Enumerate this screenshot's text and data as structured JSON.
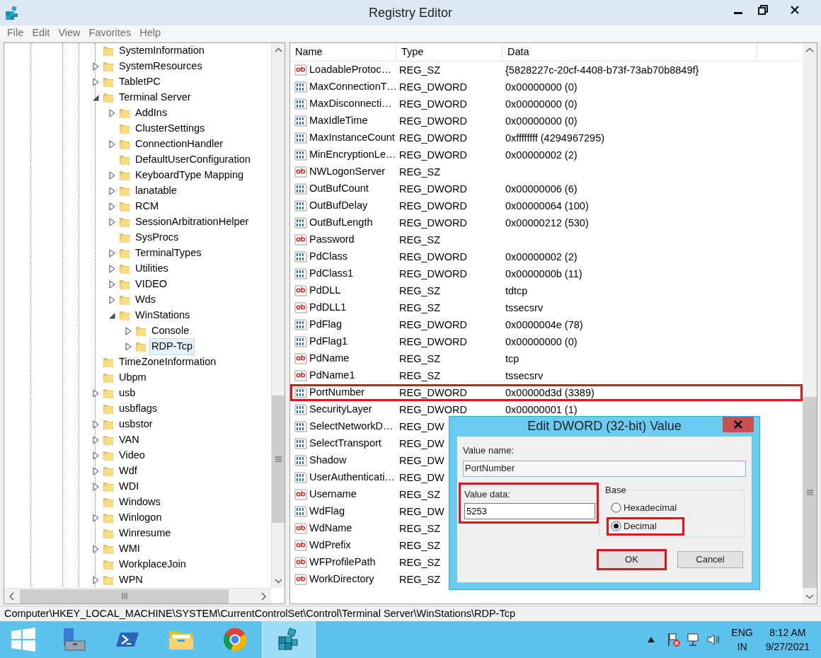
{
  "window": {
    "title": "Registry Editor"
  },
  "menu": [
    "File",
    "Edit",
    "View",
    "Favorites",
    "Help"
  ],
  "tree": [
    {
      "label": "SystemInformation",
      "expandable": false,
      "selected": false
    },
    {
      "label": "SystemResources",
      "expandable": true,
      "expanded": false,
      "selected": false
    },
    {
      "label": "TabletPC",
      "expandable": true,
      "expanded": false,
      "selected": false
    },
    {
      "label": "Terminal Server",
      "expandable": true,
      "expanded": true,
      "selected": false,
      "children": [
        {
          "label": "AddIns",
          "expandable": true,
          "expanded": false,
          "selected": false
        },
        {
          "label": "ClusterSettings",
          "expandable": false,
          "selected": false
        },
        {
          "label": "ConnectionHandler",
          "expandable": true,
          "expanded": false,
          "selected": false
        },
        {
          "label": "DefaultUserConfiguration",
          "expandable": false,
          "selected": false
        },
        {
          "label": "KeyboardType Mapping",
          "expandable": true,
          "expanded": false,
          "selected": false
        },
        {
          "label": "lanatable",
          "expandable": true,
          "expanded": false,
          "selected": false
        },
        {
          "label": "RCM",
          "expandable": true,
          "expanded": false,
          "selected": false
        },
        {
          "label": "SessionArbitrationHelper",
          "expandable": true,
          "expanded": false,
          "selected": false
        },
        {
          "label": "SysProcs",
          "expandable": false,
          "selected": false
        },
        {
          "label": "TerminalTypes",
          "expandable": true,
          "expanded": false,
          "selected": false
        },
        {
          "label": "Utilities",
          "expandable": true,
          "expanded": false,
          "selected": false
        },
        {
          "label": "VIDEO",
          "expandable": true,
          "expanded": false,
          "selected": false
        },
        {
          "label": "Wds",
          "expandable": true,
          "expanded": false,
          "selected": false
        },
        {
          "label": "WinStations",
          "expandable": true,
          "expanded": true,
          "selected": false,
          "children": [
            {
              "label": "Console",
              "expandable": true,
              "expanded": false,
              "selected": false
            },
            {
              "label": "RDP-Tcp",
              "expandable": true,
              "expanded": false,
              "selected": true
            }
          ]
        }
      ]
    },
    {
      "label": "TimeZoneInformation",
      "expandable": false,
      "selected": false
    },
    {
      "label": "Ubpm",
      "expandable": false,
      "selected": false
    },
    {
      "label": "usb",
      "expandable": true,
      "expanded": false,
      "selected": false
    },
    {
      "label": "usbflags",
      "expandable": false,
      "selected": false
    },
    {
      "label": "usbstor",
      "expandable": true,
      "expanded": false,
      "selected": false
    },
    {
      "label": "VAN",
      "expandable": true,
      "expanded": false,
      "selected": false
    },
    {
      "label": "Video",
      "expandable": true,
      "expanded": false,
      "selected": false
    },
    {
      "label": "Wdf",
      "expandable": true,
      "expanded": false,
      "selected": false
    },
    {
      "label": "WDI",
      "expandable": true,
      "expanded": false,
      "selected": false
    },
    {
      "label": "Windows",
      "expandable": false,
      "selected": false
    },
    {
      "label": "Winlogon",
      "expandable": true,
      "expanded": false,
      "selected": false
    },
    {
      "label": "Winresume",
      "expandable": false,
      "selected": false
    },
    {
      "label": "WMI",
      "expandable": true,
      "expanded": false,
      "selected": false
    },
    {
      "label": "WorkplaceJoin",
      "expandable": false,
      "selected": false
    },
    {
      "label": "WPN",
      "expandable": true,
      "expanded": false,
      "selected": false
    }
  ],
  "list": {
    "columns": [
      "Name",
      "Type",
      "Data"
    ],
    "rows": [
      {
        "name": "LoadableProtoc…",
        "type": "REG_SZ",
        "data": "{5828227c-20cf-4408-b73f-73ab70b8849f}",
        "kind": "string",
        "highlighted": false
      },
      {
        "name": "MaxConnectionT…",
        "type": "REG_DWORD",
        "data": "0x00000000 (0)",
        "kind": "dword",
        "highlighted": false
      },
      {
        "name": "MaxDisconnecti…",
        "type": "REG_DWORD",
        "data": "0x00000000 (0)",
        "kind": "dword",
        "highlighted": false
      },
      {
        "name": "MaxIdleTime",
        "type": "REG_DWORD",
        "data": "0x00000000 (0)",
        "kind": "dword",
        "highlighted": false
      },
      {
        "name": "MaxInstanceCount",
        "type": "REG_DWORD",
        "data": "0xffffffff (4294967295)",
        "kind": "dword",
        "highlighted": false
      },
      {
        "name": "MinEncryptionLe…",
        "type": "REG_DWORD",
        "data": "0x00000002 (2)",
        "kind": "dword",
        "highlighted": false
      },
      {
        "name": "NWLogonServer",
        "type": "REG_SZ",
        "kind": "string",
        "highlighted": false
      },
      {
        "name": "OutBufCount",
        "type": "REG_DWORD",
        "data": "0x00000006 (6)",
        "kind": "dword",
        "highlighted": false
      },
      {
        "name": "OutBufDelay",
        "type": "REG_DWORD",
        "data": "0x00000064 (100)",
        "kind": "dword",
        "highlighted": false
      },
      {
        "name": "OutBufLength",
        "type": "REG_DWORD",
        "data": "0x00000212 (530)",
        "kind": "dword",
        "highlighted": false
      },
      {
        "name": "Password",
        "type": "REG_SZ",
        "kind": "string",
        "highlighted": false
      },
      {
        "name": "PdClass",
        "type": "REG_DWORD",
        "data": "0x00000002 (2)",
        "kind": "dword",
        "highlighted": false
      },
      {
        "name": "PdClass1",
        "type": "REG_DWORD",
        "data": "0x0000000b (11)",
        "kind": "dword",
        "highlighted": false
      },
      {
        "name": "PdDLL",
        "type": "REG_SZ",
        "data": "tdtcp",
        "kind": "string",
        "highlighted": false
      },
      {
        "name": "PdDLL1",
        "type": "REG_SZ",
        "data": "tssecsrv",
        "kind": "string",
        "highlighted": false
      },
      {
        "name": "PdFlag",
        "type": "REG_DWORD",
        "data": "0x0000004e (78)",
        "kind": "dword",
        "highlighted": false
      },
      {
        "name": "PdFlag1",
        "type": "REG_DWORD",
        "data": "0x00000000 (0)",
        "kind": "dword",
        "highlighted": false
      },
      {
        "name": "PdName",
        "type": "REG_SZ",
        "data": "tcp",
        "kind": "string",
        "highlighted": false
      },
      {
        "name": "PdName1",
        "type": "REG_SZ",
        "data": "tssecsrv",
        "kind": "string",
        "highlighted": false
      },
      {
        "name": "PortNumber",
        "type": "REG_DWORD",
        "data": "0x00000d3d (3389)",
        "kind": "dword",
        "highlighted": true
      },
      {
        "name": "SecurityLayer",
        "type": "REG_DWORD",
        "data": "0x00000001 (1)",
        "kind": "dword",
        "highlighted": false
      },
      {
        "name": "SelectNetworkD…",
        "type": "REG_DW",
        "kind": "dword",
        "highlighted": false
      },
      {
        "name": "SelectTransport",
        "type": "REG_DW",
        "kind": "dword",
        "highlighted": false
      },
      {
        "name": "Shadow",
        "type": "REG_DW",
        "kind": "dword",
        "highlighted": false
      },
      {
        "name": "UserAuthenticati…",
        "type": "REG_DW",
        "kind": "dword",
        "highlighted": false
      },
      {
        "name": "Username",
        "type": "REG_SZ",
        "kind": "string",
        "highlighted": false
      },
      {
        "name": "WdFlag",
        "type": "REG_DW",
        "kind": "dword",
        "highlighted": false
      },
      {
        "name": "WdName",
        "type": "REG_SZ",
        "kind": "string",
        "highlighted": false
      },
      {
        "name": "WdPrefix",
        "type": "REG_SZ",
        "kind": "string",
        "highlighted": false
      },
      {
        "name": "WFProfilePath",
        "type": "REG_SZ",
        "kind": "string",
        "highlighted": false
      },
      {
        "name": "WorkDirectory",
        "type": "REG_SZ",
        "kind": "string",
        "highlighted": false
      }
    ]
  },
  "status_bar": "Computer\\HKEY_LOCAL_MACHINE\\SYSTEM\\CurrentControlSet\\Control\\Terminal Server\\WinStations\\RDP-Tcp",
  "dialog": {
    "title": "Edit DWORD (32-bit) Value",
    "value_name_label": "Value name:",
    "value_name": "PortNumber",
    "value_data_label": "Value data:",
    "value_data": "5253",
    "value_data_highlighted": true,
    "base_label": "Base",
    "base_options": [
      {
        "label": "Hexadecimal",
        "selected": false,
        "highlighted": false
      },
      {
        "label": "Decimal",
        "selected": true,
        "highlighted": true
      }
    ],
    "buttons": [
      {
        "label": "OK",
        "highlighted": true
      },
      {
        "label": "Cancel",
        "highlighted": false
      }
    ]
  },
  "taskbar": {
    "apps": [
      {
        "kind": "server_manager",
        "active": false
      },
      {
        "kind": "powershell",
        "active": false
      },
      {
        "kind": "explorer",
        "active": false
      },
      {
        "kind": "browser",
        "active": false
      },
      {
        "kind": "regedit",
        "active": true
      }
    ],
    "tray": {
      "language": "ENG",
      "region": "IN",
      "time": "8:12 AM",
      "date": "9/27/2021"
    }
  }
}
